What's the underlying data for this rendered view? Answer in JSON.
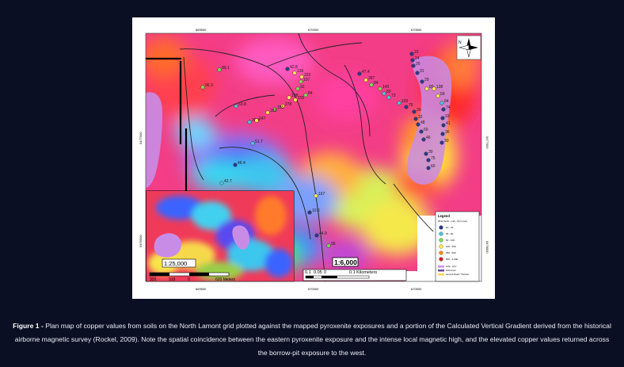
{
  "map": {
    "coords": {
      "top": [
        "669500",
        "670000",
        "670500"
      ],
      "bottom": [
        "669500",
        "670000",
        "670500"
      ],
      "left": [
        "5477000",
        "5476500"
      ],
      "right": [
        "5477000",
        "5476500"
      ]
    },
    "samples": [
      {
        "label": "89.1",
        "color": "#7ed957"
      },
      {
        "label": "96.3",
        "color": "#7ed957"
      },
      {
        "label": "53.8",
        "color": "#4fc3d9"
      },
      {
        "label": "30.3",
        "color": "#4fc3d9"
      },
      {
        "label": "247",
        "color": "#ffe84d"
      },
      {
        "label": "51.7",
        "color": "#4fc3d9"
      },
      {
        "label": "46.4",
        "color": "#2b3a8a"
      },
      {
        "label": "42.7",
        "color": "#4fc3d9"
      },
      {
        "label": "26.5",
        "color": "#2b3a8a"
      },
      {
        "label": "42.8",
        "color": "#2b3a8a"
      },
      {
        "label": "136",
        "color": "#ffe84d"
      },
      {
        "label": "222",
        "color": "#ffe84d"
      },
      {
        "label": "107",
        "color": "#7ed957"
      },
      {
        "label": "92",
        "color": "#7ed957"
      },
      {
        "label": "84",
        "color": "#7ed957"
      },
      {
        "label": "198",
        "color": "#ffe84d"
      },
      {
        "label": "155",
        "color": "#ffe84d"
      },
      {
        "label": "278",
        "color": "#ffe84d"
      },
      {
        "label": "155",
        "color": "#7ed957"
      },
      {
        "label": "183",
        "color": "#ffe84d"
      },
      {
        "label": "167",
        "color": "#ffe84d"
      },
      {
        "label": "10.6",
        "color": "#2b3a8a"
      },
      {
        "label": "44.9",
        "color": "#2b3a8a"
      },
      {
        "label": "95",
        "color": "#7ed957"
      },
      {
        "label": "47.4",
        "color": "#2b3a8a"
      },
      {
        "label": "287",
        "color": "#ffe84d"
      },
      {
        "label": "84",
        "color": "#7ed957"
      },
      {
        "label": "143",
        "color": "#7ed957"
      },
      {
        "label": "80",
        "color": "#4fc3d9"
      },
      {
        "label": "73",
        "color": "#4fc3d9"
      },
      {
        "label": "103",
        "color": "#4fc3d9"
      },
      {
        "label": "76",
        "color": "#2b3a8a"
      },
      {
        "label": "39",
        "color": "#2b3a8a"
      },
      {
        "label": "32",
        "color": "#2b3a8a"
      },
      {
        "label": "48",
        "color": "#2b3a8a"
      },
      {
        "label": "60",
        "color": "#2b3a8a"
      },
      {
        "label": "46",
        "color": "#2b3a8a"
      },
      {
        "label": "30",
        "color": "#2b3a8a"
      },
      {
        "label": "75",
        "color": "#2b3a8a"
      },
      {
        "label": "60",
        "color": "#2b3a8a"
      },
      {
        "label": "23",
        "color": "#2b3a8a"
      },
      {
        "label": "24",
        "color": "#2b3a8a"
      },
      {
        "label": "26",
        "color": "#2b3a8a"
      },
      {
        "label": "31",
        "color": "#2b3a8a"
      },
      {
        "label": "29",
        "color": "#2b3a8a"
      },
      {
        "label": "89",
        "color": "#ffe84d"
      },
      {
        "label": "138",
        "color": "#ffe84d"
      },
      {
        "label": "59",
        "color": "#ffe84d"
      },
      {
        "label": "64",
        "color": "#4fc3d9"
      },
      {
        "label": "74",
        "color": "#2b3a8a"
      },
      {
        "label": "33",
        "color": "#2b3a8a"
      },
      {
        "label": "41",
        "color": "#2b3a8a"
      },
      {
        "label": "36",
        "color": "#2b3a8a"
      },
      {
        "label": "30",
        "color": "#2b3a8a"
      }
    ],
    "main_scale": {
      "ratio": "1:6,000",
      "ticks": [
        "0.1",
        "0.05",
        "0",
        "0.1 Kilometers"
      ]
    },
    "inset_scale": {
      "ratio": "1:25,000",
      "ticks": [
        "320",
        "319",
        "0",
        "620 Meters"
      ]
    },
    "legend": {
      "title": "Legend",
      "subtitle": "2014 Soils - Lab - Ppm (Cu)",
      "items": [
        {
          "label": "10 - 25",
          "color": "#2b3a8a"
        },
        {
          "label": "25 - 50",
          "color": "#4fc3d9"
        },
        {
          "label": "50 - 100",
          "color": "#7ed957"
        },
        {
          "label": "100 - 250",
          "color": "#ffe84d"
        },
        {
          "label": "250 - 500",
          "color": "#ff8c1a"
        },
        {
          "label": "500 - 1,000",
          "color": "#e01919"
        }
      ],
      "extra": [
        "Litho - Ppx",
        "Grid Lines",
        "Lamont Road / Trackes"
      ]
    },
    "north": "N"
  },
  "caption": {
    "lead": "Figure 1 -",
    "text": " Plan map of copper values from soils on the North Lamont grid plotted against the mapped pyroxenite exposures and a portion of the Calculated Vertical Gradient derived from the historical airborne magnetic survey (Rockel, 2009). Note the spatial coincidence between the eastern pyroxenite exposure and the intense local magnetic high, and the elevated copper values returned across the borrow-pit exposure to the west."
  }
}
